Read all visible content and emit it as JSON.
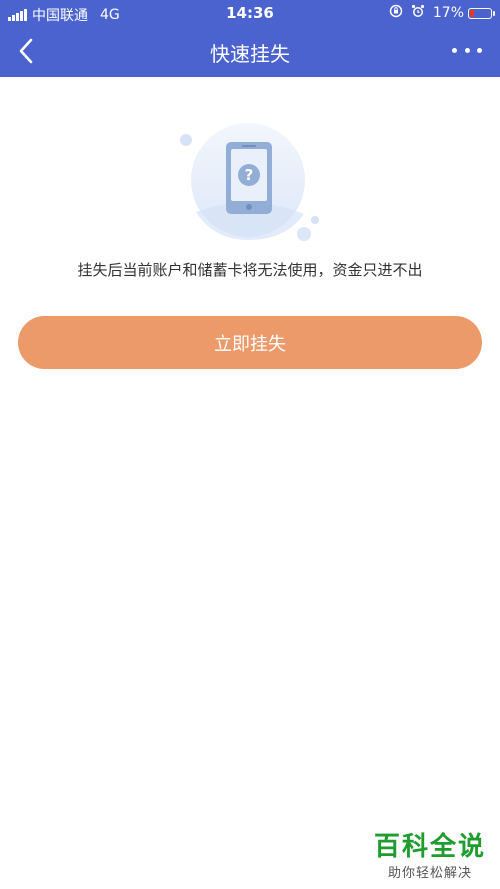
{
  "status_bar": {
    "carrier": "中国联通",
    "network": "4G",
    "time": "14:36",
    "battery": "17%",
    "battery_level": 0.17
  },
  "navbar": {
    "title": "快速挂失"
  },
  "icons": {
    "back": "chevron-left-icon",
    "more": "more-dots-icon",
    "illustration": "phone-question-icon"
  },
  "content": {
    "message": "挂失后当前账户和储蓄卡将无法使用，资金只进不出",
    "button_label": "立即挂失"
  },
  "watermark": {
    "main": "百科全说",
    "sub": "助你轻松解决"
  },
  "colors": {
    "header": "#4a63cf",
    "button": "#ec9a69",
    "watermark": "#1f9c2e"
  }
}
